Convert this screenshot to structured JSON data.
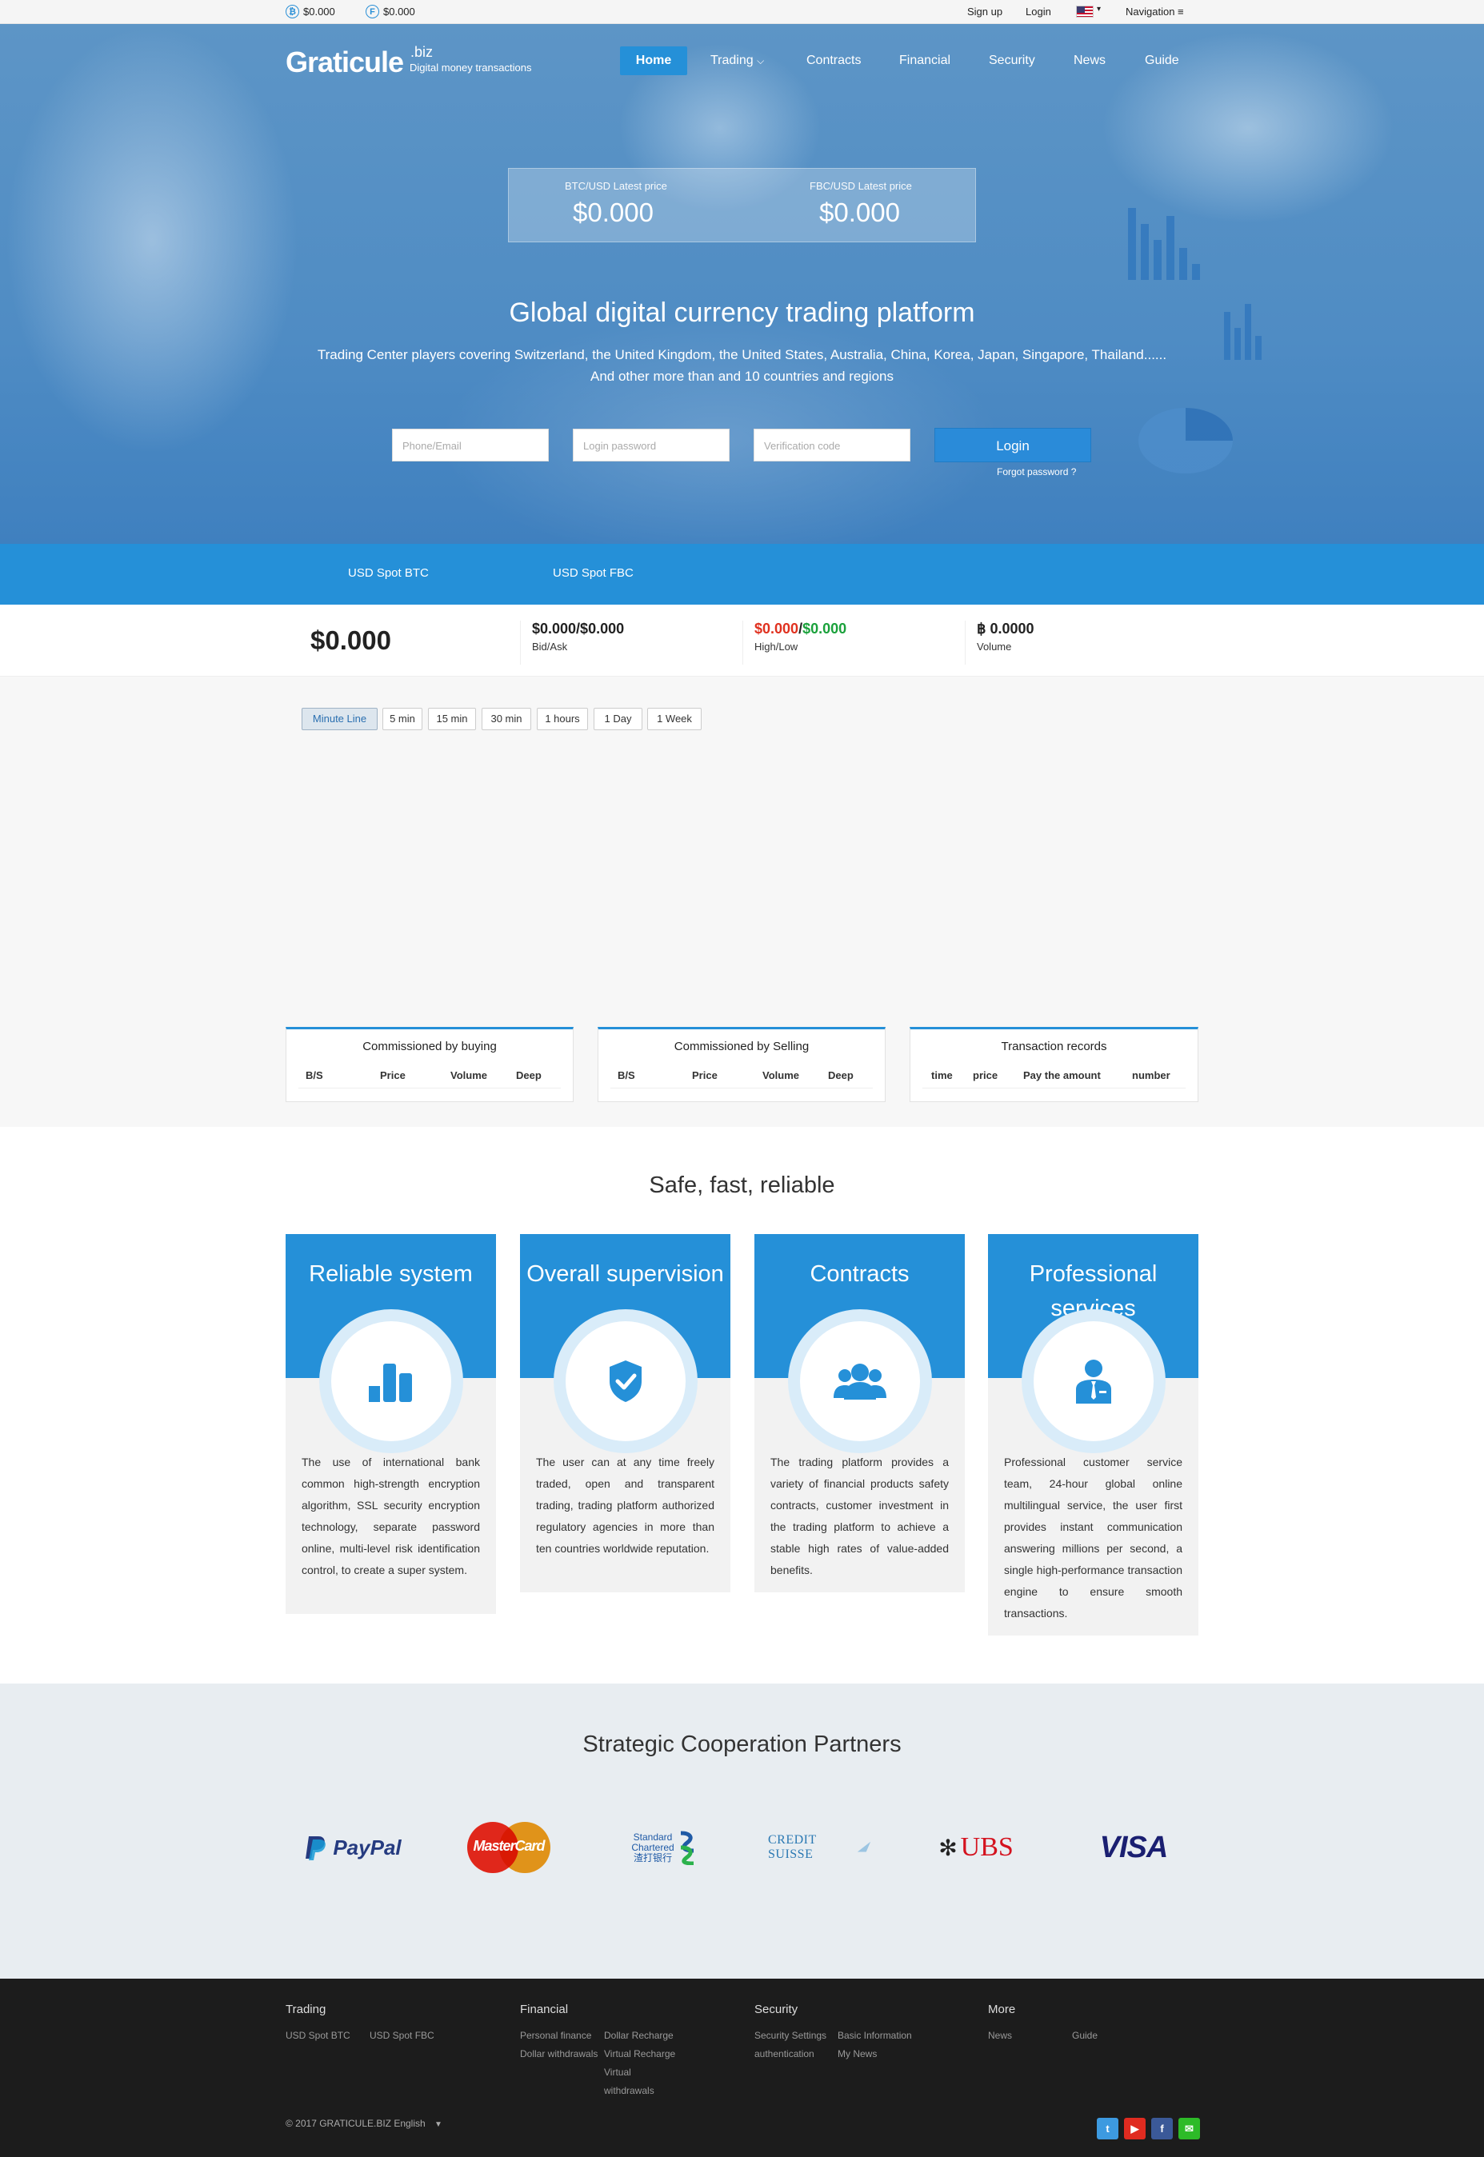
{
  "topbar": {
    "btc_price": "$0.000",
    "fbc_price": "$0.000",
    "signup": "Sign up",
    "login": "Login",
    "navigation": "Navigation ≡"
  },
  "header": {
    "logo": "Graticule",
    "logo_suffix": ".biz",
    "tagline": "Digital money transactions",
    "nav": [
      "Home",
      "Trading",
      "Contracts",
      "Financial",
      "Security",
      "News",
      "Guide"
    ]
  },
  "hero": {
    "btc_label": "BTC/USD Latest price",
    "btc_value": "$0.000",
    "fbc_label": "FBC/USD Latest price",
    "fbc_value": "$0.000",
    "headline": "Global digital currency trading platform",
    "subline1": "Trading Center players covering Switzerland, the United Kingdom, the United States, Australia, China, Korea, Japan, Singapore, Thailand......",
    "subline2": "And other more than and 10 countries and regions",
    "phone_placeholder": "Phone/Email",
    "password_placeholder": "Login password",
    "code_placeholder": "Verification code",
    "login_button": "Login",
    "forgot": "Forgot password ?"
  },
  "market_tabs": [
    "USD Spot BTC",
    "USD Spot FBC"
  ],
  "stats": {
    "last_price": "$0.000",
    "bid_ask": "$0.000/$0.000",
    "bid_ask_label": "Bid/Ask",
    "high": "$0.000",
    "low": "$0.000",
    "high_low_label": "High/Low",
    "volume": "฿ 0.0000",
    "volume_label": "Volume"
  },
  "timeframes": [
    "Minute Line",
    "5 min",
    "15 min",
    "30 min",
    "1 hours",
    "1 Day",
    "1 Week"
  ],
  "panels": {
    "buying": {
      "title": "Commissioned by buying",
      "cols": [
        "B/S",
        "Price",
        "Volume",
        "Deep"
      ]
    },
    "selling": {
      "title": "Commissioned by Selling",
      "cols": [
        "B/S",
        "Price",
        "Volume",
        "Deep"
      ]
    },
    "records": {
      "title": "Transaction records",
      "cols": [
        "time",
        "price",
        "Pay the amount",
        "number"
      ]
    }
  },
  "features": {
    "title": "Safe, fast, reliable",
    "cards": [
      {
        "title": "Reliable system",
        "icon": "bar-chart-icon",
        "text": "The use of international bank common high-strength encryption algorithm, SSL security encryption technology, separate password online, multi-level risk identification control, to create a super system."
      },
      {
        "title": "Overall supervision",
        "icon": "shield-check-icon",
        "text": "The user can at any time freely traded, open and transparent trading, trading platform authorized regulatory agencies in more than ten countries worldwide reputation."
      },
      {
        "title": "Contracts",
        "icon": "users-icon",
        "text": "The trading platform provides a variety of financial products safety contracts, customer investment in the trading platform to achieve a stable high rates of value-added benefits."
      },
      {
        "title": "Professional services",
        "icon": "support-agent-icon",
        "text": "Professional customer service team, 24-hour global online multilingual service, the user first provides instant communication answering millions per second, a single high-performance transaction engine to ensure smooth transactions."
      }
    ]
  },
  "partners": {
    "title": "Strategic Cooperation Partners",
    "logos": {
      "paypal": "PayPal",
      "mastercard": "MasterCard",
      "standard_chartered_1": "Standard",
      "standard_chartered_2": "Chartered",
      "standard_chartered_3": "渣打银行",
      "credit_suisse": "CREDIT SUISSE",
      "ubs": "UBS",
      "visa": "VISA"
    }
  },
  "footer": {
    "trading": {
      "title": "Trading",
      "links": [
        "USD Spot BTC",
        "USD Spot FBC"
      ]
    },
    "financial": {
      "title": "Financial",
      "links": [
        "Personal finance",
        "Dollar withdrawals",
        "Dollar Recharge",
        "Virtual Recharge",
        "Virtual withdrawals"
      ]
    },
    "security": {
      "title": "Security",
      "links": [
        "Security Settings",
        "authentication",
        "Basic Information",
        "My News"
      ]
    },
    "more": {
      "title": "More",
      "links": [
        "News",
        "Guide"
      ]
    },
    "copyright": "© 2017 GRATICULE.BIZ English",
    "colors": {
      "twitter": "#3d9ae0",
      "youtube": "#e02b20",
      "facebook": "#3b5998",
      "wechat": "#2dbb28"
    }
  },
  "colors": {
    "accent": "#2590d8",
    "red": "#e0311f",
    "green": "#1aa13b",
    "footer_bg": "#1c1c1c"
  }
}
